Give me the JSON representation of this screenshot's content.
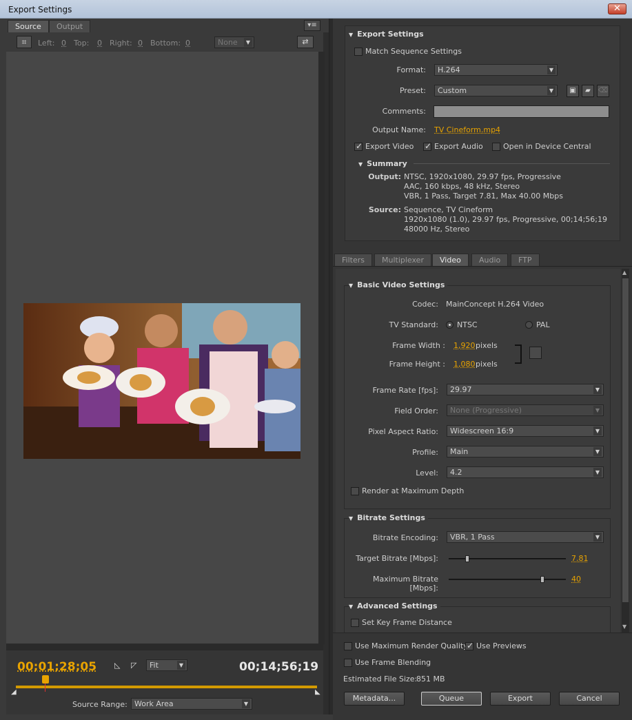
{
  "window": {
    "title": "Export Settings"
  },
  "left": {
    "tabs": [
      "Source",
      "Output"
    ],
    "crop": {
      "left_label": "Left:",
      "left": "0",
      "top_label": "Top:",
      "top": "0",
      "right_label": "Right:",
      "right": "0",
      "bottom_label": "Bottom:",
      "bottom": "0",
      "ratio": "None"
    },
    "timecode_current": "00;01;28;05",
    "timecode_duration": "00;14;56;19",
    "zoom": "Fit",
    "source_range_label": "Source Range:",
    "source_range": "Work Area"
  },
  "export": {
    "title": "Export Settings",
    "match_sequence": "Match Sequence Settings",
    "format_label": "Format:",
    "format": "H.264",
    "preset_label": "Preset:",
    "preset": "Custom",
    "comments_label": "Comments:",
    "output_name_label": "Output Name:",
    "output_name": "TV Cineform.mp4",
    "export_video": "Export Video",
    "export_audio": "Export Audio",
    "open_device_central": "Open in Device Central",
    "summary_title": "Summary",
    "output_label": "Output:",
    "output_lines": [
      "NTSC, 1920x1080, 29.97 fps, Progressive",
      "AAC, 160 kbps, 48 kHz, Stereo",
      "VBR, 1 Pass, Target 7.81, Max 40.00 Mbps"
    ],
    "source_label": "Source:",
    "source_lines": [
      "Sequence, TV Cineform",
      "1920x1080 (1.0), 29.97 fps, Progressive, 00;14;56;19",
      "48000 Hz, Stereo"
    ]
  },
  "settings_tabs": [
    "Filters",
    "Multiplexer",
    "Video",
    "Audio",
    "FTP"
  ],
  "basic_video": {
    "title": "Basic Video Settings",
    "codec_label": "Codec:",
    "codec": "MainConcept H.264 Video",
    "tv_standard_label": "TV Standard:",
    "ntsc": "NTSC",
    "pal": "PAL",
    "frame_width_label": "Frame Width :",
    "frame_width": "1,920",
    "frame_height_label": "Frame Height :",
    "frame_height": "1,080",
    "pixels": "pixels",
    "frame_rate_label": "Frame Rate [fps]:",
    "frame_rate": "29.97",
    "field_order_label": "Field Order:",
    "field_order": "None (Progressive)",
    "par_label": "Pixel Aspect Ratio:",
    "par": "Widescreen 16:9",
    "profile_label": "Profile:",
    "profile": "Main",
    "level_label": "Level:",
    "level": "4.2",
    "render_max_depth": "Render at Maximum Depth"
  },
  "bitrate": {
    "title": "Bitrate Settings",
    "encoding_label": "Bitrate Encoding:",
    "encoding": "VBR, 1 Pass",
    "target_label": "Target Bitrate [Mbps]:",
    "target": "7.81",
    "target_fraction": 0.16,
    "max_label": "Maximum Bitrate [Mbps]:",
    "max": "40",
    "max_fraction": 0.8
  },
  "advanced": {
    "title": "Advanced Settings",
    "key_frame": "Set Key Frame Distance"
  },
  "footer": {
    "max_render_quality": "Use Maximum Render Quality",
    "use_previews": "Use Previews",
    "frame_blending": "Use Frame Blending",
    "file_size_label": "Estimated File Size:",
    "file_size": "851 MB",
    "metadata": "Metadata...",
    "queue": "Queue",
    "export": "Export",
    "cancel": "Cancel"
  }
}
